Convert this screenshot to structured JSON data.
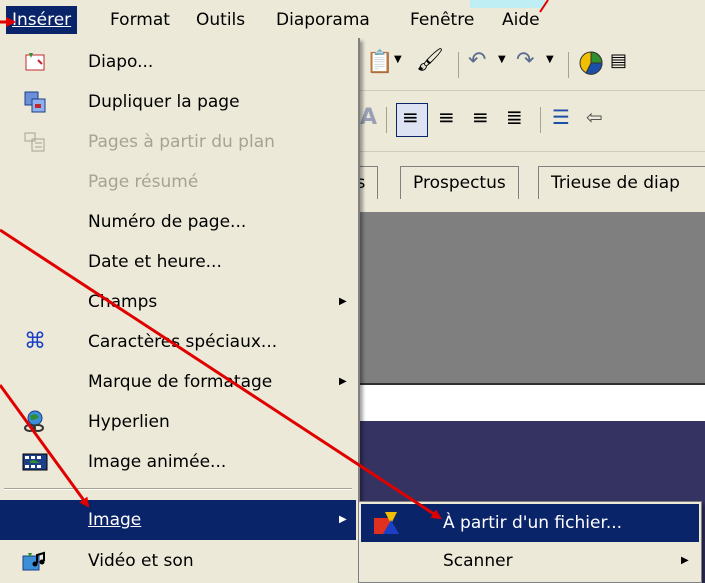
{
  "menubar": {
    "items": [
      "Insérer",
      "Format",
      "Outils",
      "Diaporama",
      "Fenêtre",
      "Aide"
    ]
  },
  "tabs": {
    "items": [
      "es",
      "Prospectus",
      "Trieuse de diap"
    ]
  },
  "insert_menu": {
    "items": [
      {
        "label": "Diapo...",
        "icon": "slide-icon"
      },
      {
        "label": "Dupliquer la page",
        "icon": "duplicate-page-icon"
      },
      {
        "label": "Pages à partir du plan",
        "icon": "outline-pages-icon",
        "disabled": true
      },
      {
        "label": "Page résumé",
        "disabled": true
      },
      {
        "label": "Numéro de page..."
      },
      {
        "label": "Date et heure..."
      },
      {
        "label": "Champs",
        "submenu": true
      },
      {
        "label": "Caractères spéciaux...",
        "icon": "special-characters-icon"
      },
      {
        "label": "Marque de formatage",
        "submenu": true
      },
      {
        "label": "Hyperlien",
        "icon": "hyperlink-icon"
      },
      {
        "label": "Image animée...",
        "icon": "animated-image-icon"
      },
      {
        "label": "Image",
        "submenu": true,
        "highlighted": true
      },
      {
        "label": "Vidéo et son",
        "icon": "video-sound-icon"
      }
    ]
  },
  "image_submenu": {
    "items": [
      {
        "label": "À partir d'un fichier...",
        "icon": "from-file-icon",
        "highlighted": true
      },
      {
        "label": "Scanner",
        "submenu": true
      }
    ]
  },
  "colors": {
    "menu_bg": "#ece9d8",
    "highlight": "#0a246a",
    "disabled_text": "#a7a391",
    "annotation_arrow": "#e00000"
  }
}
